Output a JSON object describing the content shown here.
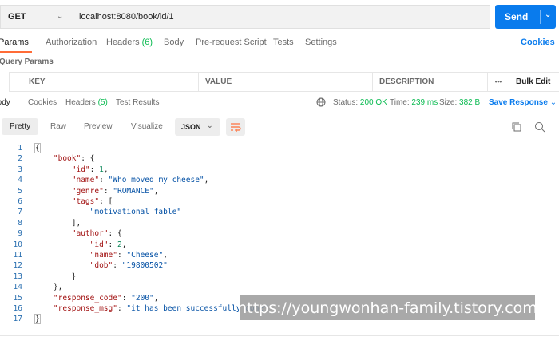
{
  "request": {
    "method": "GET",
    "url": "localhost:8080/book/id/1",
    "send_label": "Send"
  },
  "request_tabs": {
    "params": "Params",
    "authorization": "Authorization",
    "headers": "Headers",
    "headers_count": "(6)",
    "body": "Body",
    "prerequest": "Pre-request Script",
    "tests": "Tests",
    "settings": "Settings",
    "cookies": "Cookies"
  },
  "query_params": {
    "label": "Query Params",
    "columns": [
      "KEY",
      "VALUE",
      "DESCRIPTION"
    ],
    "more": "•••",
    "bulk_edit": "Bulk Edit"
  },
  "response_tabs": {
    "body": "Body",
    "cookies": "Cookies",
    "headers": "Headers",
    "headers_count": "(5)",
    "test_results": "Test Results",
    "status_label": "Status:",
    "status_value": "200 OK",
    "time_label": "Time:",
    "time_value": "239 ms",
    "size_label": "Size:",
    "size_value": "382 B",
    "save_response": "Save Response"
  },
  "response_toolbar": {
    "pretty": "Pretty",
    "raw": "Raw",
    "preview": "Preview",
    "visualize": "Visualize",
    "format": "JSON"
  },
  "code_lines": [
    "{",
    "    \"book\": {",
    "        \"id\": 1,",
    "        \"name\": \"Who moved my cheese\",",
    "        \"genre\": \"ROMANCE\",",
    "        \"tags\": [",
    "            \"motivational fable\"",
    "        ],",
    "        \"author\": {",
    "            \"id\": 2,",
    "            \"name\": \"Cheese\",",
    "            \"dob\": \"19800502\"",
    "        }",
    "    },",
    "    \"response_code\": \"200\",",
    "    \"response_msg\": \"it has been successfully done\"",
    "}"
  ],
  "watermark": "https://youngwonhan-family.tistory.com",
  "colors": {
    "accent": "#097bed",
    "active_tab": "#ff6c37",
    "success": "#0cbb52",
    "json_key": "#a31515",
    "json_string": "#0451a5",
    "json_number": "#098658"
  }
}
